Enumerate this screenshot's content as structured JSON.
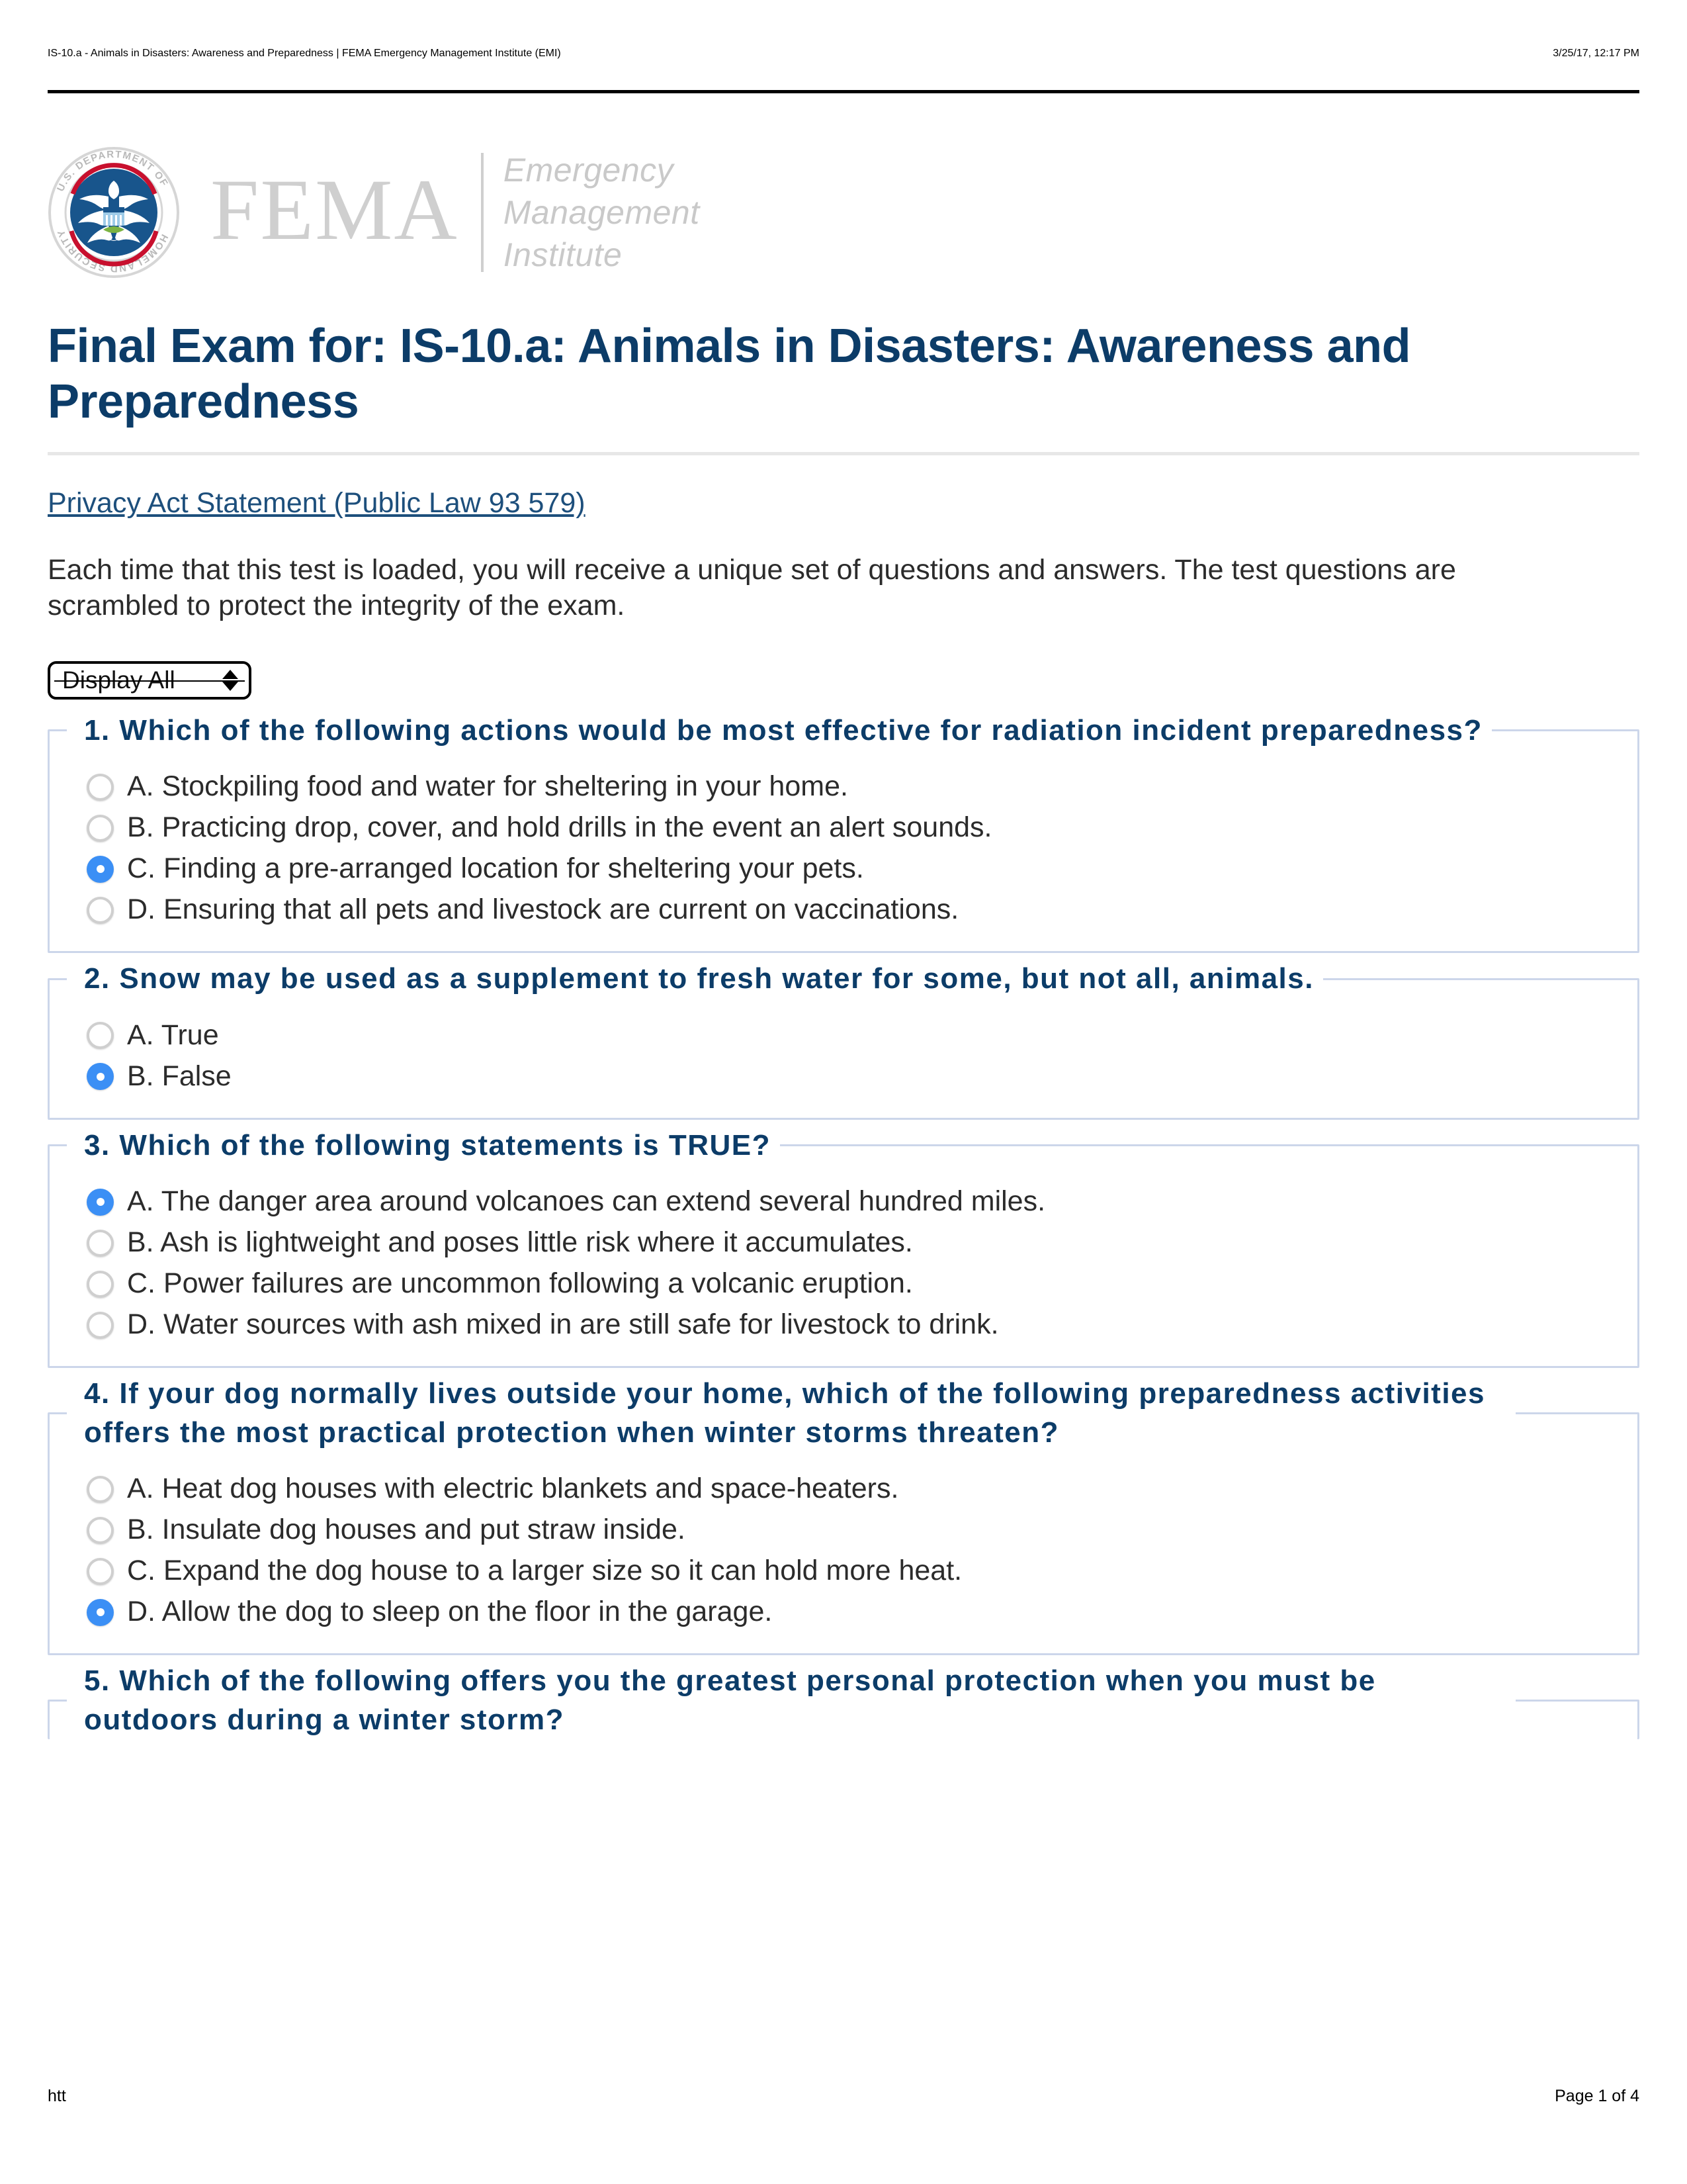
{
  "print_header": {
    "title": "IS-10.a - Animals in Disasters: Awareness and Preparedness | FEMA Emergency Management Institute (EMI)",
    "date": "3/25/17, 12:17 PM"
  },
  "logo": {
    "seal_alt": "U.S. DEPARTMENT OF HOMELAND SECURITY",
    "seal_ring_top": "U.S. DEPARTMENT OF",
    "seal_ring_bottom": "HOMELAND SECURITY",
    "fema": "FEMA",
    "emi_line1": "Emergency",
    "emi_line2": "Management",
    "emi_line3": "Institute",
    "colors": {
      "seal_blue": "#18558c",
      "seal_red": "#c8102e",
      "seal_ring": "#d6d6d6",
      "wordmark_gray": "#cfcfcf"
    }
  },
  "page_title": "Final Exam for: IS-10.a: Animals in Disasters: Awareness and Preparedness",
  "privacy_link": "Privacy Act Statement (Public Law 93 579)",
  "intro": "Each time that this test is loaded, you will receive a unique set of questions and answers. The test questions are scrambled to protect the integrity of the exam.",
  "display_select": {
    "value": "Display All",
    "options": [
      "Display All"
    ]
  },
  "colors": {
    "heading_navy": "#0c3c68",
    "link_navy": "#1d4f7c",
    "body_text": "#2b2b2b",
    "fieldset_border": "#ccd6ea",
    "radio_selected": "#3b8ff5",
    "radio_unselected": "#cfcfcf",
    "rule_gray": "#e7e7e7"
  },
  "questions": [
    {
      "number": "1.",
      "text": "1. Which of the following actions would be most effective for radiation incident preparedness?",
      "options": [
        {
          "label": "A. Stockpiling food and water for sheltering in your home.",
          "selected": false
        },
        {
          "label": "B. Practicing drop, cover, and hold drills in the event an alert sounds.",
          "selected": false
        },
        {
          "label": "C. Finding a pre-arranged location for sheltering your pets.",
          "selected": true
        },
        {
          "label": "D. Ensuring that all pets and livestock are current on vaccinations.",
          "selected": false
        }
      ]
    },
    {
      "number": "2.",
      "text": "2. Snow may be used as a supplement to fresh water for some, but not all, animals.",
      "options": [
        {
          "label": "A. True",
          "selected": false
        },
        {
          "label": "B. False",
          "selected": true
        }
      ]
    },
    {
      "number": "3.",
      "text": "3. Which of the following statements is TRUE?",
      "options": [
        {
          "label": "A. The danger area around volcanoes can extend several hundred miles.",
          "selected": true
        },
        {
          "label": "B. Ash is lightweight and poses little risk where it accumulates.",
          "selected": false
        },
        {
          "label": "C. Power failures are uncommon following a volcanic eruption.",
          "selected": false
        },
        {
          "label": "D. Water sources with ash mixed in are still safe for livestock to drink.",
          "selected": false
        }
      ]
    },
    {
      "number": "4.",
      "text": "4. If your dog normally lives outside your home, which of the following preparedness activities offers the most practical protection when winter storms threaten?",
      "options": [
        {
          "label": "A. Heat dog houses with electric blankets and space-heaters.",
          "selected": false
        },
        {
          "label": "B. Insulate dog houses and put straw inside.",
          "selected": false
        },
        {
          "label": "C. Expand the dog house to a larger size so it can hold more heat.",
          "selected": false
        },
        {
          "label": "D. Allow the dog to sleep on the floor in the garage.",
          "selected": true
        }
      ]
    },
    {
      "number": "5.",
      "text": "5. Which of the following offers you the greatest personal protection when you must be outdoors during a winter storm?",
      "options": []
    }
  ],
  "print_footer": {
    "url": "htt",
    "page": "Page 1 of 4"
  }
}
